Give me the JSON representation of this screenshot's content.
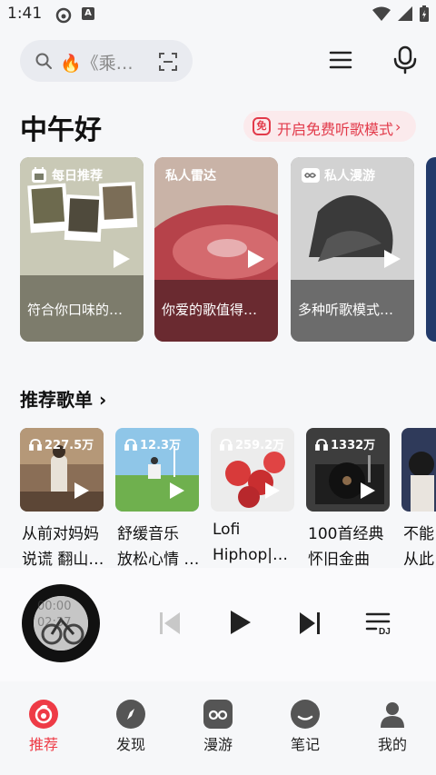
{
  "status_bar": {
    "time": "1:41"
  },
  "search": {
    "text": "🔥《乘…"
  },
  "greeting": "中午好",
  "free_mode": {
    "badge": "免",
    "label": "开启免费听歌模式"
  },
  "hero_cards": [
    {
      "tag": "每日推荐",
      "caption": "符合你口味的…"
    },
    {
      "tag": "私人雷达",
      "caption": "你爱的歌值得…"
    },
    {
      "tag": "私人漫游",
      "caption": "多种听歌模式…"
    }
  ],
  "recommended": {
    "title": "推荐歌单",
    "playlists": [
      {
        "count": "227.5万",
        "line1": "从前对妈妈",
        "line2": "说谎 翻山…"
      },
      {
        "count": "12.3万",
        "line1": "舒缓音乐",
        "line2": "放松心情 …"
      },
      {
        "count": "259.2万",
        "line1": "Lofi",
        "line2": "Hiphop|…"
      },
      {
        "count": "1332万",
        "line1": "100首经典",
        "line2": "怀旧金曲"
      },
      {
        "count": "",
        "line1": "不能",
        "line2": "从此"
      }
    ]
  },
  "player": {
    "time_overlay_1": "00:00",
    "time_overlay_2": "02:37"
  },
  "tabs": [
    {
      "label": "推荐",
      "icon": "netease-logo-icon",
      "active": true
    },
    {
      "label": "发现",
      "icon": "compass-icon",
      "active": false
    },
    {
      "label": "漫游",
      "icon": "radio-icon",
      "active": false
    },
    {
      "label": "笔记",
      "icon": "chat-icon",
      "active": false
    },
    {
      "label": "我的",
      "icon": "person-icon",
      "active": false
    }
  ],
  "colors": {
    "accent": "#ee3b46",
    "background": "#f6f7f9"
  }
}
